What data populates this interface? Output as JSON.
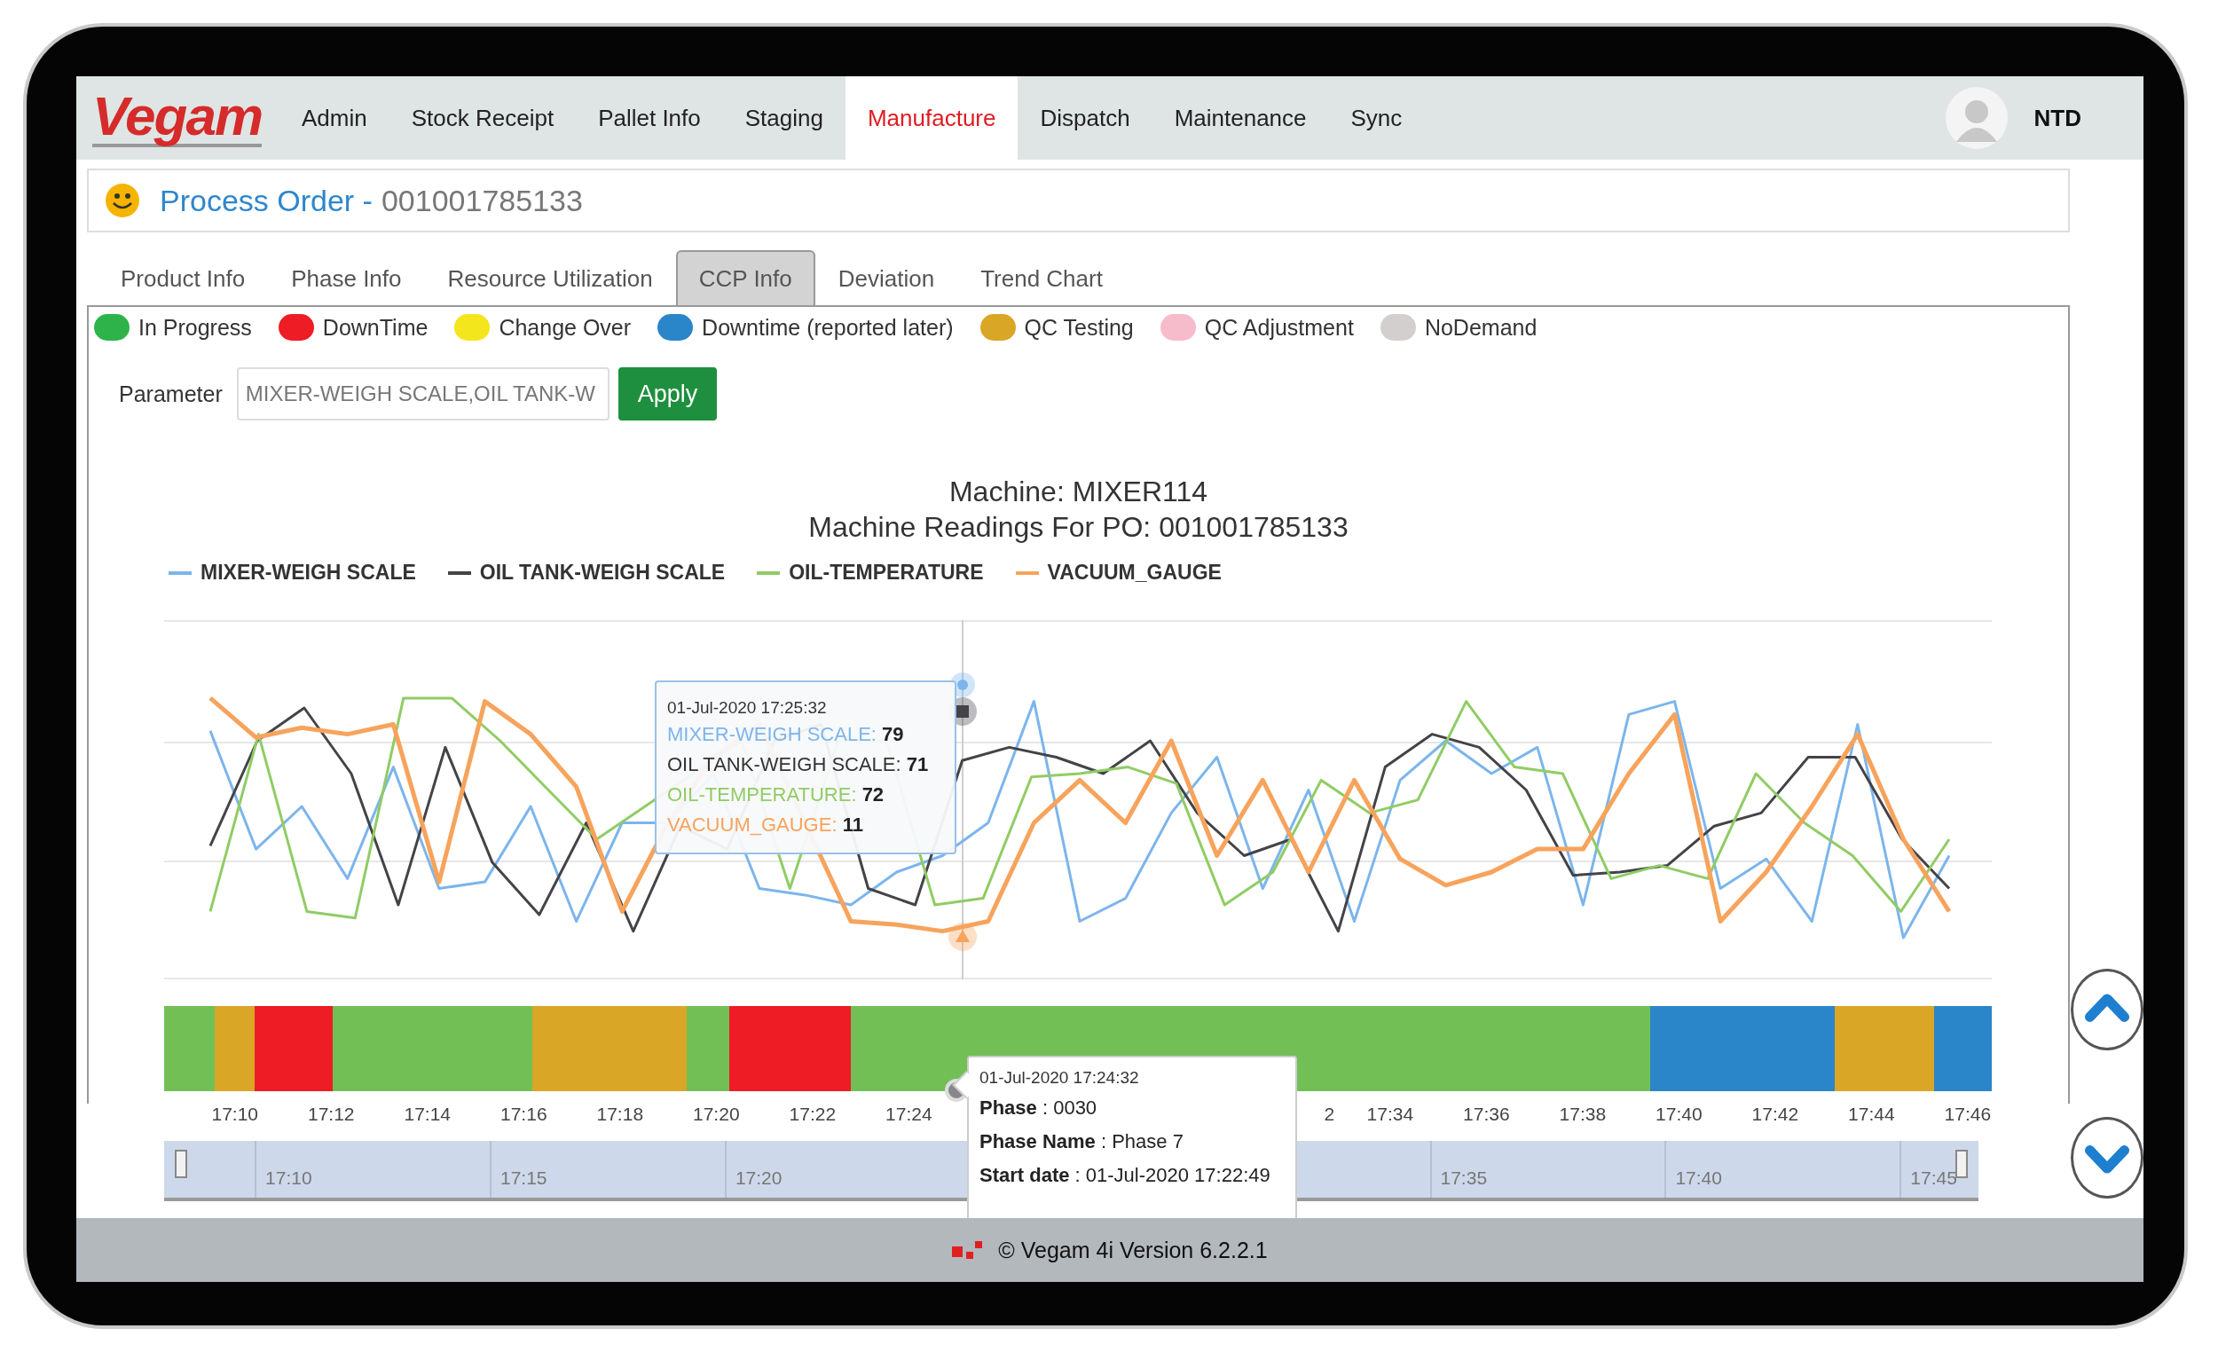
{
  "nav": {
    "logo": "Vegam",
    "menu": [
      {
        "label": "Admin",
        "selected": false
      },
      {
        "label": "Stock Receipt",
        "selected": false
      },
      {
        "label": "Pallet Info",
        "selected": false
      },
      {
        "label": "Staging",
        "selected": false
      },
      {
        "label": "Manufacture",
        "selected": true
      },
      {
        "label": "Dispatch",
        "selected": false
      },
      {
        "label": "Maintenance",
        "selected": false
      },
      {
        "label": "Sync",
        "selected": false
      }
    ],
    "user": "NTD"
  },
  "process_order": {
    "label": "Process Order -",
    "number": "001001785133"
  },
  "tabs": [
    {
      "label": "Product Info",
      "selected": false
    },
    {
      "label": "Phase Info",
      "selected": false
    },
    {
      "label": "Resource Utilization",
      "selected": false
    },
    {
      "label": "CCP Info",
      "selected": true
    },
    {
      "label": "Deviation",
      "selected": false
    },
    {
      "label": "Trend Chart",
      "selected": false
    }
  ],
  "status_legend": [
    {
      "label": "In Progress",
      "color": "#2db34a"
    },
    {
      "label": "DownTime",
      "color": "#ee1c25"
    },
    {
      "label": "Change Over",
      "color": "#f4e61c"
    },
    {
      "label": "Downtime (reported later)",
      "color": "#2a86c9"
    },
    {
      "label": "QC Testing",
      "color": "#daa626"
    },
    {
      "label": "QC Adjustment",
      "color": "#f7bccb"
    },
    {
      "label": "NoDemand",
      "color": "#d3cfcf"
    }
  ],
  "parameter": {
    "label": "Parameter",
    "value": "MIXER-WEIGH SCALE,OIL TANK-W",
    "button": "Apply"
  },
  "chart": {
    "title": "Machine: MIXER114",
    "subtitle": "Machine Readings For PO: 001001785133",
    "series": [
      {
        "name": "MIXER-WEIGH SCALE",
        "color": "#7cb5ec"
      },
      {
        "name": "OIL TANK-WEIGH SCALE",
        "color": "#434348"
      },
      {
        "name": "OIL-TEMPERATURE",
        "color": "#90cc64"
      },
      {
        "name": "VACUUM_GAUGE",
        "color": "#f7a35c"
      }
    ],
    "tooltip": {
      "title": "01-Jul-2020 17:25:32",
      "entries": [
        {
          "text": "MIXER-WEIGH SCALE: **79**",
          "color": "#7cb5ec"
        },
        {
          "text": "OIL TANK-WEIGH SCALE: **71**",
          "color": "#333333"
        },
        {
          "text": "OIL-TEMPERATURE: **72**",
          "color": "#90cc64"
        },
        {
          "text": "VACUUM_GAUGE: **11**",
          "color": "#f7a35c"
        }
      ]
    }
  },
  "timeline": {
    "segments": [
      {
        "color": "#72bf56"
      },
      {
        "color": "#daa626"
      },
      {
        "color": "#ee1c25"
      },
      {
        "color": "#72bf56"
      },
      {
        "color": "#daa626"
      },
      {
        "color": "#72bf56"
      },
      {
        "color": "#ee1c25"
      },
      {
        "color": "#72bf56"
      },
      {
        "color": "#2a86c9"
      },
      {
        "color": "#daa626"
      },
      {
        "color": "#2a86c9"
      }
    ],
    "ticks": [
      "17:10",
      "17:12",
      "17:14",
      "17:16",
      "17:18",
      "17:20",
      "17:22",
      "17:24",
      "2",
      "17:34",
      "17:36",
      "17:38",
      "17:40",
      "17:42",
      "17:44",
      "17:46"
    ],
    "tooltip": {
      "title": "01-Jul-2020 17:24:32",
      "lines": [
        "**Phase** : 0030",
        "**Phase Name** : Phase 7",
        "**Start date** : 01-Jul-2020 17:22:49"
      ]
    }
  },
  "navigator": {
    "ticks": [
      "17:10",
      "17:15",
      "17:20",
      "17:35",
      "17:40",
      "17:45"
    ]
  },
  "footer": {
    "text": "© Vegam 4i Version 6.2.2.1"
  }
}
